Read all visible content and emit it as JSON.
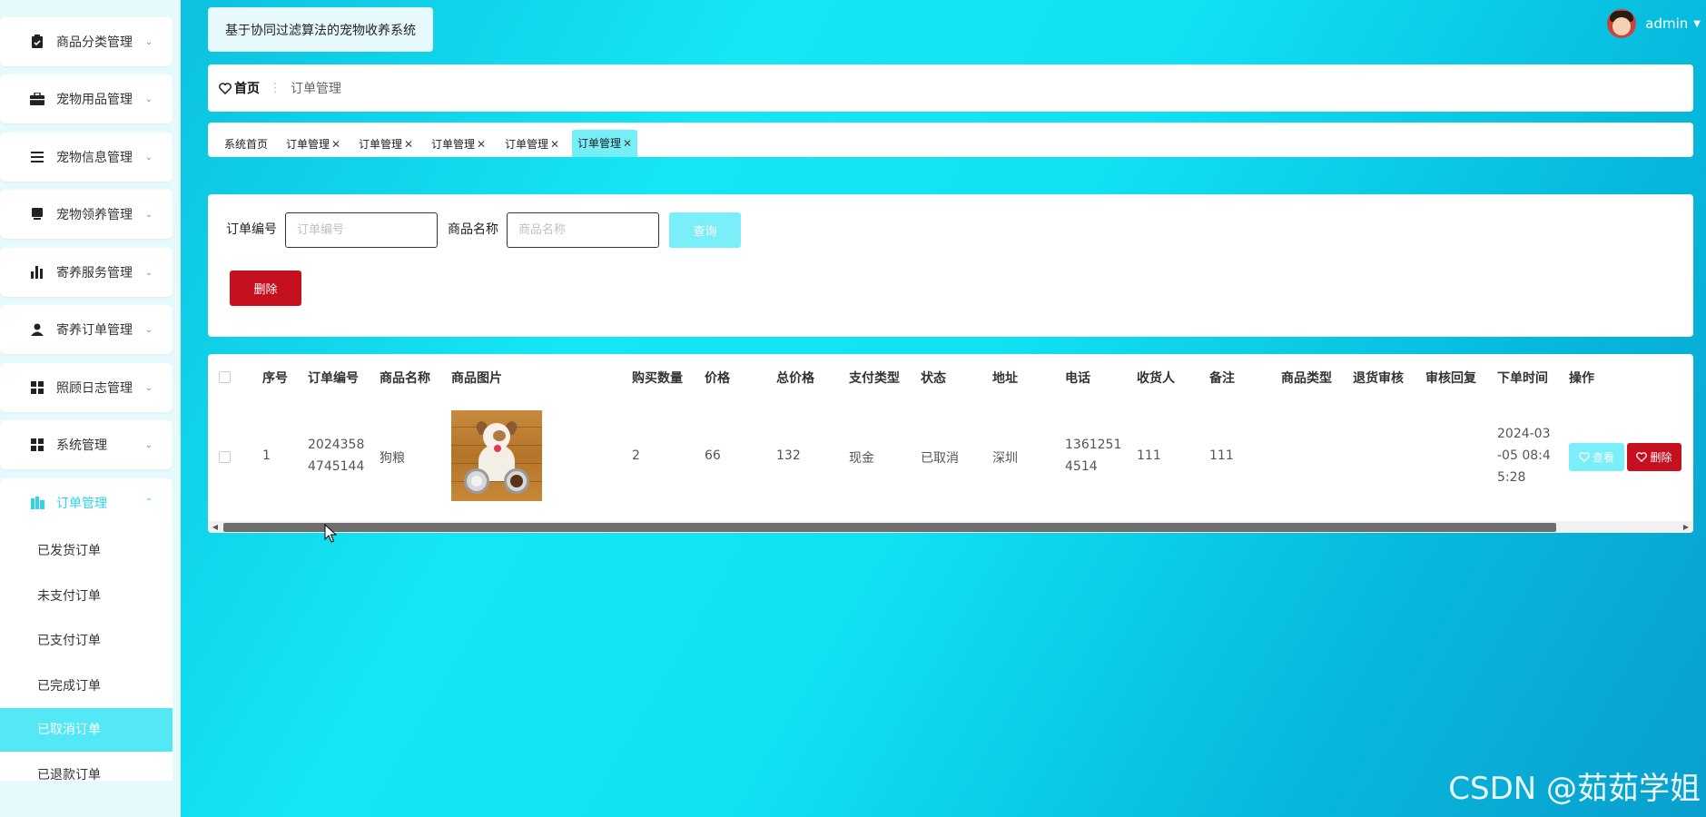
{
  "sidebar": {
    "menu": [
      {
        "label": "商品分类管理",
        "icon": "clipboard-icon"
      },
      {
        "label": "宠物用品管理",
        "icon": "briefcase-icon"
      },
      {
        "label": "宠物信息管理",
        "icon": "list-icon"
      },
      {
        "label": "宠物领养管理",
        "icon": "monitor-icon"
      },
      {
        "label": "寄养服务管理",
        "icon": "bar-chart-icon"
      },
      {
        "label": "寄养订单管理",
        "icon": "user-icon"
      },
      {
        "label": "照顾日志管理",
        "icon": "grid-icon"
      },
      {
        "label": "系统管理",
        "icon": "grid-icon"
      },
      {
        "label": "订单管理",
        "icon": "order-icon"
      }
    ],
    "submenu": [
      {
        "label": "已发货订单"
      },
      {
        "label": "未支付订单"
      },
      {
        "label": "已支付订单"
      },
      {
        "label": "已完成订单"
      },
      {
        "label": "已取消订单"
      },
      {
        "label": "已退款订单"
      }
    ],
    "accent": "#2fd4ea"
  },
  "header": {
    "system_title": "基于协同过滤算法的宠物收养系统",
    "username": "admin"
  },
  "breadcrumb": {
    "home": "首页",
    "separator": "⋮",
    "current": "订单管理"
  },
  "tags": [
    {
      "label": "系统首页",
      "closable": false
    },
    {
      "label": "订单管理",
      "closable": true
    },
    {
      "label": "订单管理",
      "closable": true
    },
    {
      "label": "订单管理",
      "closable": true
    },
    {
      "label": "订单管理",
      "closable": true
    },
    {
      "label": "订单管理",
      "closable": true,
      "active": true
    }
  ],
  "search": {
    "order_no_label": "订单编号",
    "order_no_placeholder": "订单编号",
    "product_label": "商品名称",
    "product_placeholder": "商品名称",
    "query_button": "查询",
    "delete_button": "删除"
  },
  "table": {
    "headers": [
      "序号",
      "订单编号",
      "商品名称",
      "商品图片",
      "购买数量",
      "价格",
      "总价格",
      "支付类型",
      "状态",
      "地址",
      "电话",
      "收货人",
      "备注",
      "商品类型",
      "退货审核",
      "审核回复",
      "下单时间",
      "操作"
    ],
    "rows": [
      {
        "index": "1",
        "order_no_l1": "2024358",
        "order_no_l2": "4745144",
        "product": "狗粮",
        "qty": "2",
        "price": "66",
        "total": "132",
        "pay_type": "现金",
        "status": "已取消",
        "address": "深圳",
        "phone_l1": "1361251",
        "phone_l2": "4514",
        "receiver": "111",
        "remark": "111",
        "type": "",
        "return_review": "",
        "review_reply": "",
        "time_l1": "2024-03",
        "time_l2": "-05 08:4",
        "time_l3": "5:28",
        "view_button": "查看",
        "delete_button": "删除"
      }
    ]
  },
  "colors": {
    "primary_light": "#7aeef9",
    "danger": "#c4101f"
  },
  "watermark": "CSDN @茹茹学姐"
}
